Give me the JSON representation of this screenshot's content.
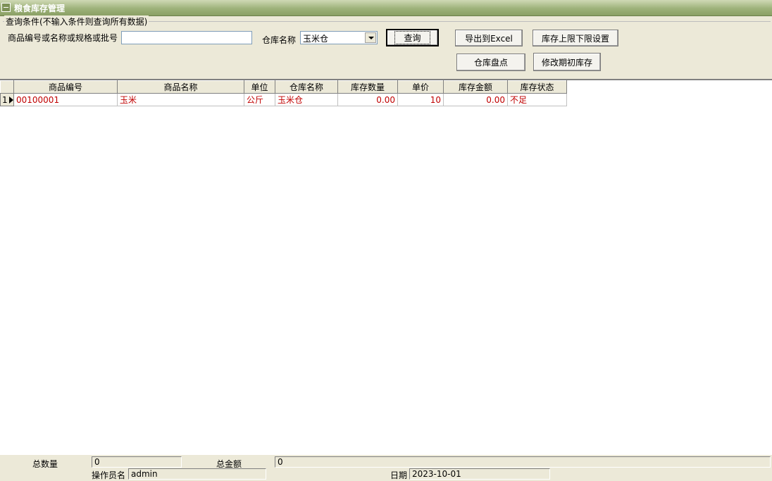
{
  "window": {
    "title": "粮食库存管理"
  },
  "query": {
    "group_title": "查询条件(不输入条件则查询所有数据)",
    "keyword_label": "商品编号或名称或规格或批号",
    "keyword_value": "",
    "warehouse_label": "仓库名称",
    "warehouse_value": "玉米仓"
  },
  "buttons": {
    "query": "查询",
    "export_excel": "导出到Excel",
    "limit_settings": "库存上限下限设置",
    "stocktake": "仓库盘点",
    "edit_initial": "修改期初库存"
  },
  "grid": {
    "columns": [
      "商品编号",
      "商品名称",
      "单位",
      "仓库名称",
      "库存数量",
      "单价",
      "库存金额",
      "库存状态"
    ],
    "rows": [
      {
        "index": "1",
        "code": "00100001",
        "name": "玉米",
        "unit": "公斤",
        "warehouse": "玉米仓",
        "qty": "0.00",
        "price": "10",
        "amount": "0.00",
        "status": "不足"
      }
    ]
  },
  "footer": {
    "total_qty_label": "总数量",
    "total_qty_value": "0",
    "total_amount_label": "总金额",
    "total_amount_value": "0",
    "operator_label": "操作员名",
    "operator_value": "admin",
    "date_label": "日期",
    "date_value": "2023-10-01"
  },
  "colors": {
    "title_green": "#8aa064",
    "row_text_red": "#c00000",
    "face": "#ece9d8"
  }
}
